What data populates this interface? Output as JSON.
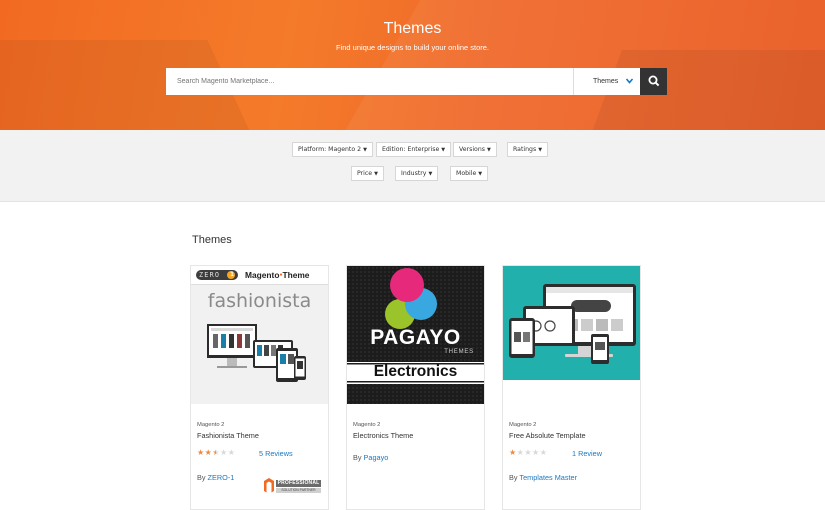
{
  "hero": {
    "title": "Themes",
    "subtitle": "Find unique designs to build your online store."
  },
  "search": {
    "placeholder": "Search Magento Marketplace...",
    "category": "Themes",
    "submit_icon": "search-icon"
  },
  "filters": {
    "row1": [
      "Platform: Magento 2",
      "Edition: Enterprise",
      "Versions",
      "Ratings"
    ],
    "row2": [
      "Price",
      "Industry",
      "Mobile"
    ]
  },
  "section": {
    "title": "Themes"
  },
  "cards": [
    {
      "platform": "Magento 2",
      "name": "Fashionista Theme",
      "rating": 2.5,
      "reviews": "5 Reviews",
      "by_label": "By",
      "vendor": "ZERO-1",
      "thumb": {
        "brand": "ZERO",
        "brand_badge": "1",
        "header": "Magento",
        "header_suffix": "Theme",
        "title": "fashionista"
      },
      "badge": {
        "line1": "PROFESSIONAL",
        "line2": "SOLUTION PARTNER"
      }
    },
    {
      "platform": "Magento 2",
      "name": "Electronics Theme",
      "rating": 0,
      "reviews": "",
      "by_label": "By",
      "vendor": "Pagayo",
      "thumb": {
        "title": "PAGAYO",
        "subtitle": "THEMES",
        "banner": "Electronics"
      }
    },
    {
      "platform": "Magento 2",
      "name": "Free Absolute Template",
      "rating": 1,
      "reviews": "1 Review",
      "by_label": "By",
      "vendor": "Templates Master"
    }
  ],
  "colors": {
    "accent": "#f26a22",
    "link": "#1979c3",
    "star": "#f0893c"
  }
}
